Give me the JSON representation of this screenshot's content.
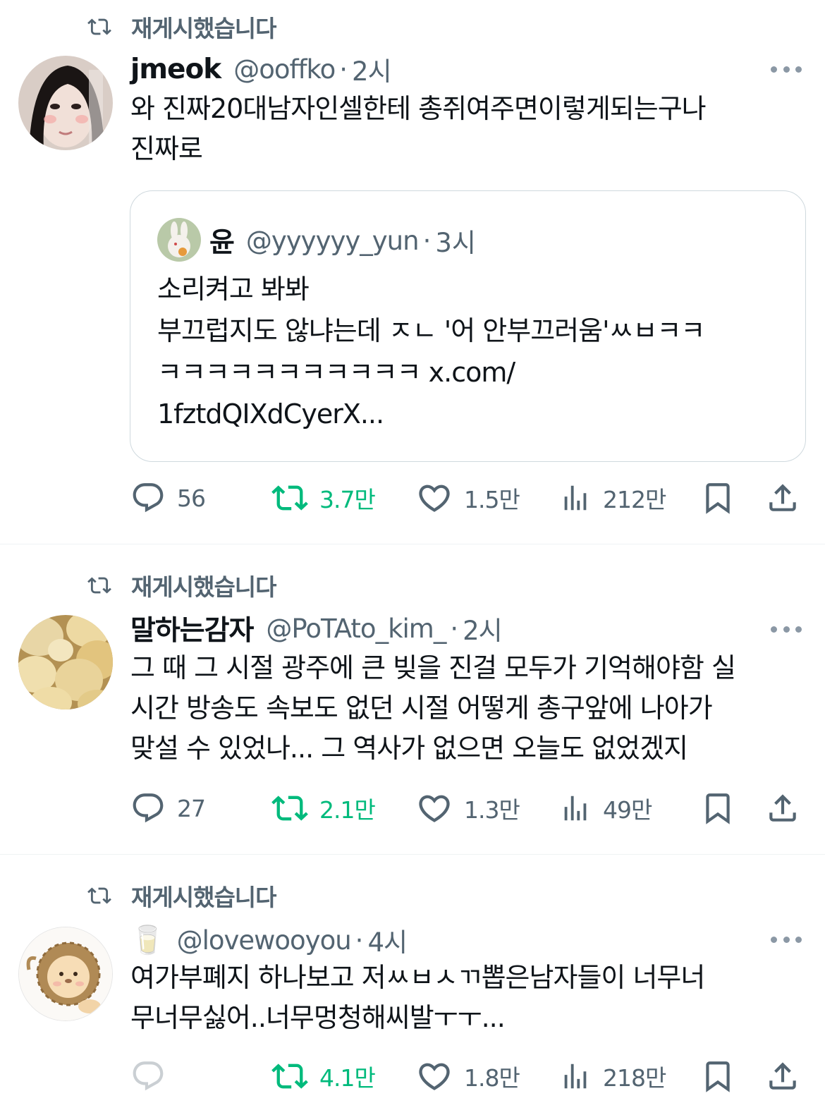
{
  "repost_label": "재게시했습니다",
  "tweets": [
    {
      "name": "jmeok",
      "handle": "@ooffko",
      "separator": "·",
      "time": "2시",
      "text": "와 진짜20대남자인셀한테 총쥐여주면이렇게되는구나\n진짜로",
      "quote": {
        "name": "윤",
        "handle": "@yyyyyy_yun",
        "time": "3시",
        "text": "소리켜고 봐봐\n부끄럽지도 않냐는데 ㅈㄴ '어 안부끄러움'ㅆㅂㅋㅋ\nㅋㅋㅋㅋㅋㅋㅋㅋㅋㅋㅋ x.com/\n1fztdQIXdCyerX..."
      },
      "replies": "56",
      "reposts": "3.7만",
      "likes": "1.5만",
      "views": "212만"
    },
    {
      "name": "말하는감자",
      "handle": "@PoTAto_kim_",
      "separator": "·",
      "time": "2시",
      "text": "그 때 그 시절 광주에 큰 빚을 진걸 모두가 기억해야함 실\n시간 방송도 속보도 없던 시절 어떻게 총구앞에 나아가\n맞설 수 있었나... 그 역사가 없으면 오늘도 없었겠지",
      "replies": "27",
      "reposts": "2.1만",
      "likes": "1.3만",
      "views": "49만"
    },
    {
      "name": "🥛",
      "handle": "@lovewooyou",
      "separator": "·",
      "time": "4시",
      "text": "여가부폐지 하나보고 저ㅆㅂㅅㄲ뽑은남자들이 너무너\n무너무싫어..너무멍청해씨발ㅜㅜ...",
      "replies": "",
      "reposts": "4.1만",
      "likes": "1.8만",
      "views": "218만"
    }
  ],
  "colors": {
    "text": "#0f1419",
    "secondary": "#536471",
    "repost_green": "#00ba7c",
    "border": "#cfd9de"
  }
}
